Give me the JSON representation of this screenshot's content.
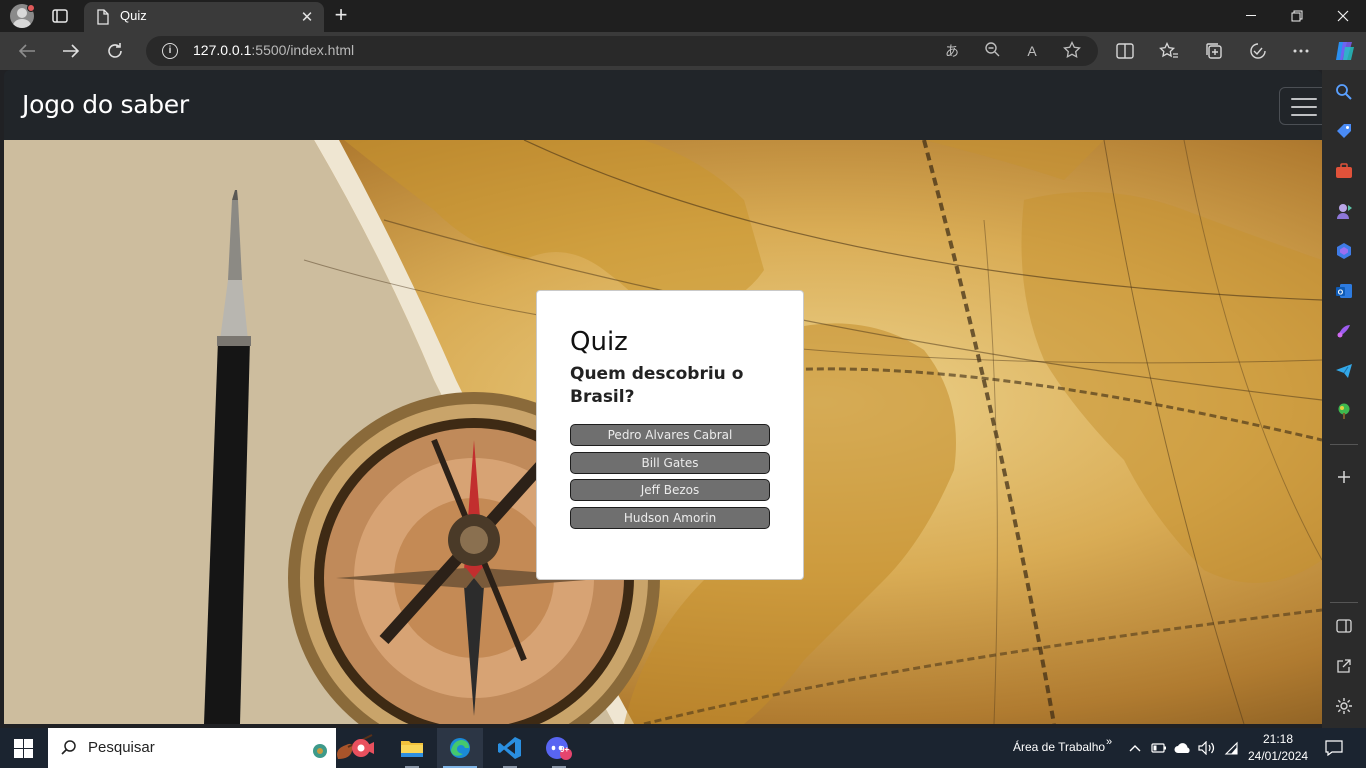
{
  "browser": {
    "tab_title": "Quiz",
    "url_host": "127.0.0.1",
    "url_path": ":5500/index.html"
  },
  "page": {
    "brand": "Jogo do saber",
    "quiz": {
      "title": "Quiz",
      "question": "Quem descobriu o Brasil?",
      "answers": [
        "Pedro Alvares Cabral",
        "Bill Gates",
        "Jeff Bezos",
        "Hudson Amorin"
      ]
    }
  },
  "taskbar": {
    "search_placeholder": "Pesquisar",
    "desktop_label": "Área de Trabalho",
    "time": "21:18",
    "date": "24/01/2024",
    "discord_badge": "9+"
  },
  "colors": {
    "navbar": "#212529",
    "answer_button": "#6f6f6f",
    "browser_chrome": "#3a3a3a",
    "taskbar": "#1b2430"
  }
}
